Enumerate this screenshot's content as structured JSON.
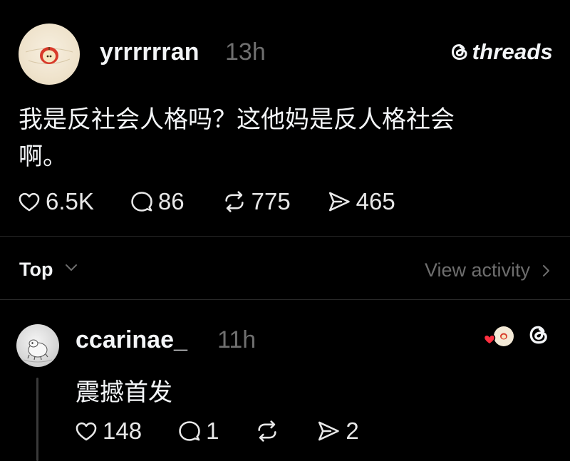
{
  "post": {
    "username": "yrrrrrran",
    "time": "13h",
    "brand": "threads",
    "brand_icon": "threads-logo-icon",
    "text_line1": "我是反社会人格吗？这他妈是反人格社会",
    "text_line2": "啊。",
    "stats": {
      "likes": "6.5K",
      "replies": "86",
      "reposts": "775",
      "shares": "465"
    }
  },
  "sort": {
    "label": "Top",
    "view_activity": "View activity"
  },
  "reply": {
    "username": "ccarinae_",
    "time": "11h",
    "text": "震撼首发",
    "stats": {
      "likes": "148",
      "replies": "1",
      "shares": "2"
    }
  },
  "colors": {
    "background": "#000000",
    "text": "#f3f5f7",
    "muted": "#6f6f6f",
    "like_red": "#ff3040"
  }
}
